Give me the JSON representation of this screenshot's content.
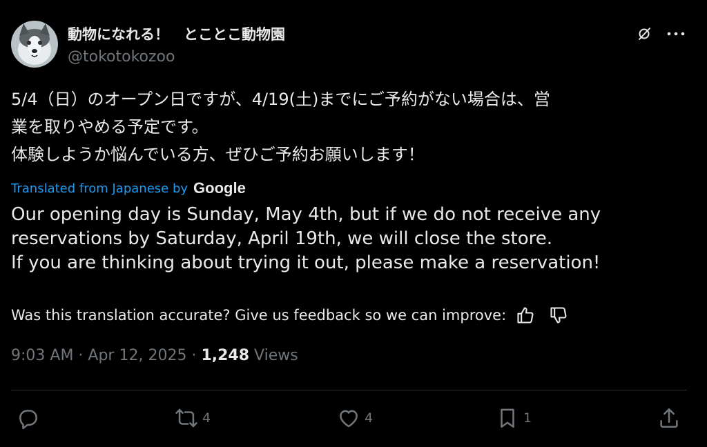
{
  "author": {
    "display_name": "動物になれる！　とことこ動物園",
    "handle": "@tokotokozoo"
  },
  "tweet": {
    "text": "5/4（日）のオープン日ですが、4/19(土)までにご予約がない場合は、営\n業を取りやめる予定です。\n体験しようか悩んでいる方、ぜひご予約お願いします！"
  },
  "translation": {
    "label": "Translated from Japanese by",
    "provider": "Google",
    "text": "Our opening day is Sunday, May 4th, but if we do not receive any\nreservations by Saturday, April 19th, we will close the store.\nIf you are thinking about trying it out, please make a reservation!",
    "feedback_prompt": "Was this translation accurate? Give us feedback so we can improve:"
  },
  "meta": {
    "time": "9:03 AM",
    "separator": " · ",
    "date": "Apr 12, 2025",
    "views_count": "1,248",
    "views_label": " Views"
  },
  "actions": {
    "replies": "",
    "reposts": "4",
    "likes": "4",
    "bookmarks": "1"
  },
  "icons": {
    "header": [
      "grok-icon",
      "more-icon"
    ],
    "actions": [
      "reply-icon",
      "repost-icon",
      "like-icon",
      "bookmark-icon",
      "share-icon"
    ],
    "feedback": [
      "thumbs-up-icon",
      "thumbs-down-icon"
    ]
  },
  "colors": {
    "background": "#000000",
    "text": "#e7e9ea",
    "muted": "#71767b",
    "link": "#1d9bf0",
    "divider": "#2f3336"
  }
}
